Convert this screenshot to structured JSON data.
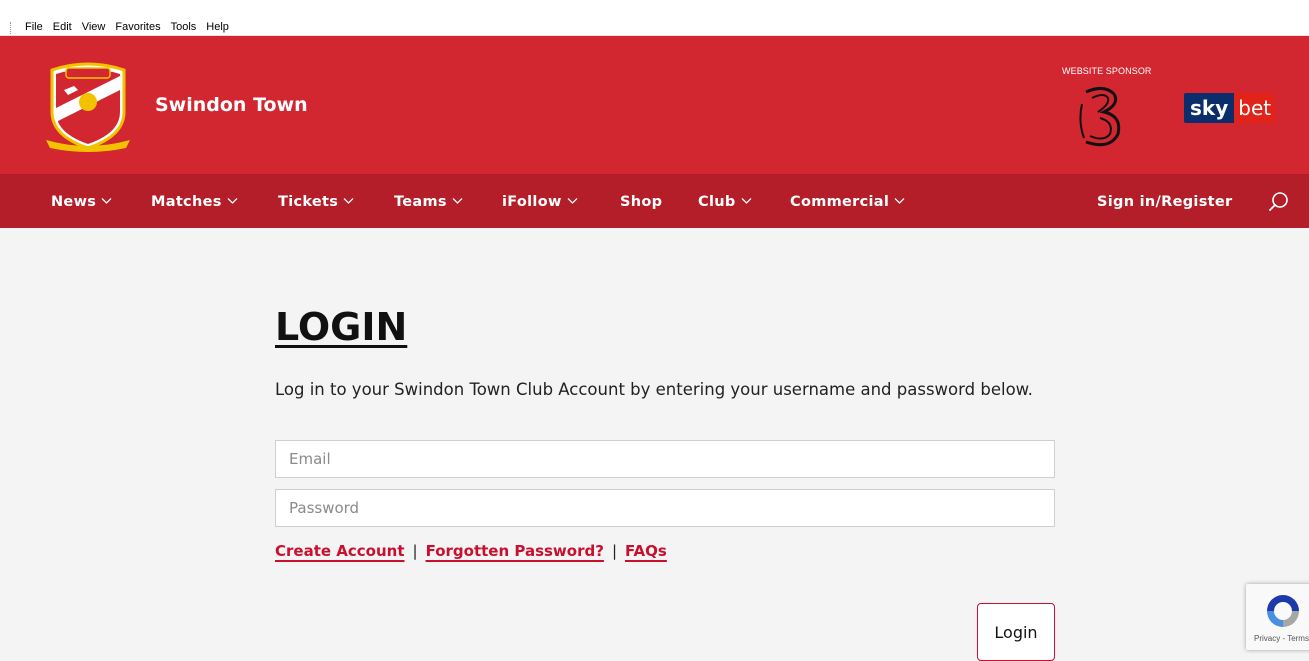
{
  "browser": {
    "menu": [
      "File",
      "Edit",
      "View",
      "Favorites",
      "Tools",
      "Help"
    ]
  },
  "header": {
    "club_name": "Swindon Town",
    "sponsor_label": "WEBSITE SPONSOR",
    "sponsor_brand_1": "Three",
    "sponsor_brand_2_sky": "sky",
    "sponsor_brand_2_bet": "bet",
    "colors": {
      "header_bg": "#d22631",
      "nav_bg": "#b31e29",
      "accent": "#c8102e"
    }
  },
  "nav": {
    "items": [
      {
        "label": "News",
        "dropdown": true
      },
      {
        "label": "Matches",
        "dropdown": true
      },
      {
        "label": "Tickets",
        "dropdown": true
      },
      {
        "label": "Teams",
        "dropdown": true
      },
      {
        "label": "iFollow",
        "dropdown": true
      },
      {
        "label": "Shop",
        "dropdown": false
      },
      {
        "label": "Club",
        "dropdown": true
      },
      {
        "label": "Commercial",
        "dropdown": true
      }
    ],
    "sign_in": "Sign in/Register",
    "search_icon": "search-icon"
  },
  "login": {
    "title": "LOGIN",
    "intro": "Log in to your Swindon Town Club Account by entering your username and password below.",
    "email_placeholder": "Email",
    "password_placeholder": "Password",
    "create_account": "Create Account",
    "forgotten_password": "Forgotten Password?",
    "faqs": "FAQs",
    "separator": "|",
    "submit": "Login"
  },
  "recaptcha": {
    "text": "Privacy - Terms"
  }
}
